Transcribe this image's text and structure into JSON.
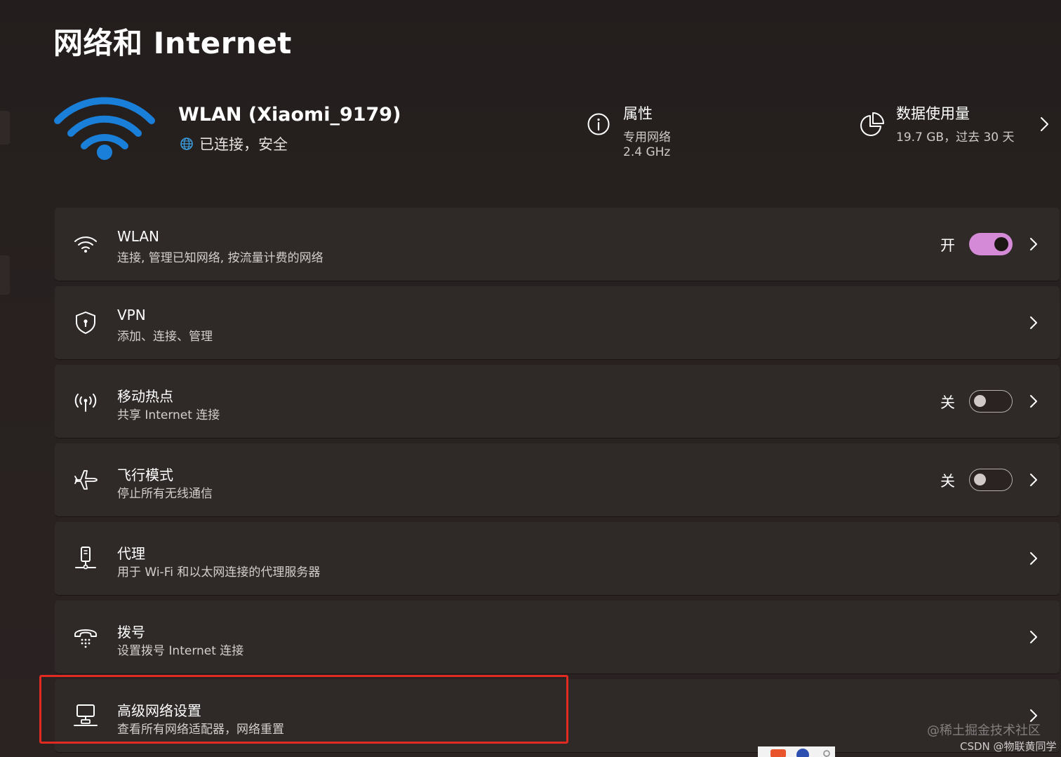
{
  "page": {
    "title": "网络和 Internet"
  },
  "network": {
    "name": "WLAN (Xiaomi_9179)",
    "status": "已连接，安全",
    "icon": "wifi-icon",
    "accent_color": "#1a7fd8"
  },
  "properties": {
    "title": "属性",
    "network_type": "专用网络",
    "band": "2.4 GHz",
    "icon": "info-icon"
  },
  "data_usage": {
    "title": "数据使用量",
    "value": "19.7 GB，过去 30 天",
    "icon": "pie-chart-icon"
  },
  "settings": [
    {
      "key": "wlan",
      "title": "WLAN",
      "subtitle": "连接, 管理已知网络, 按流量计费的网络",
      "icon": "wifi-icon",
      "toggle_label": "开",
      "toggle_on": true
    },
    {
      "key": "vpn",
      "title": "VPN",
      "subtitle": "添加、连接、管理",
      "icon": "shield-icon"
    },
    {
      "key": "hotspot",
      "title": "移动热点",
      "subtitle": "共享 Internet 连接",
      "icon": "hotspot-icon",
      "toggle_label": "关",
      "toggle_on": false
    },
    {
      "key": "airplane",
      "title": "飞行模式",
      "subtitle": "停止所有无线通信",
      "icon": "airplane-icon",
      "toggle_label": "关",
      "toggle_on": false
    },
    {
      "key": "proxy",
      "title": "代理",
      "subtitle": "用于 Wi-Fi 和以太网连接的代理服务器",
      "icon": "proxy-icon"
    },
    {
      "key": "dialup",
      "title": "拨号",
      "subtitle": "设置拨号 Internet 连接",
      "icon": "dialup-icon"
    },
    {
      "key": "advanced",
      "title": "高级网络设置",
      "subtitle": "查看所有网络适配器，网络重置",
      "icon": "computer-network-icon"
    }
  ],
  "colors": {
    "toggle_on": "#d58ad8",
    "highlight": "#e02a22",
    "background": "#272120",
    "card": "#2f2928"
  },
  "watermarks": {
    "juejin": "@稀土掘金技术社区",
    "csdn": "CSDN @物联黄同学"
  }
}
